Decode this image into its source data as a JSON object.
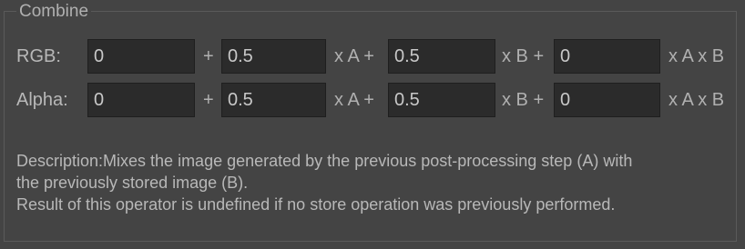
{
  "group": {
    "title": "Combine"
  },
  "rgb": {
    "label": "RGB:",
    "value1": "0",
    "op1": "+",
    "value2": "0.5",
    "op2": "x A +",
    "value3": "0.5",
    "op3": "x B +",
    "value4": "0",
    "op4": "x A x B"
  },
  "alpha": {
    "label": "Alpha:",
    "value1": "0",
    "op1": "+",
    "value2": "0.5",
    "op2": "x A +",
    "value3": "0.5",
    "op3": "x B +",
    "value4": "0",
    "op4": "x A x B"
  },
  "description": {
    "line1": "Description:Mixes the image generated by the previous post-processing step (A) with",
    "line2": "the previously stored image (B).",
    "line3": "Result of this operator is undefined if no store operation was previously performed."
  }
}
